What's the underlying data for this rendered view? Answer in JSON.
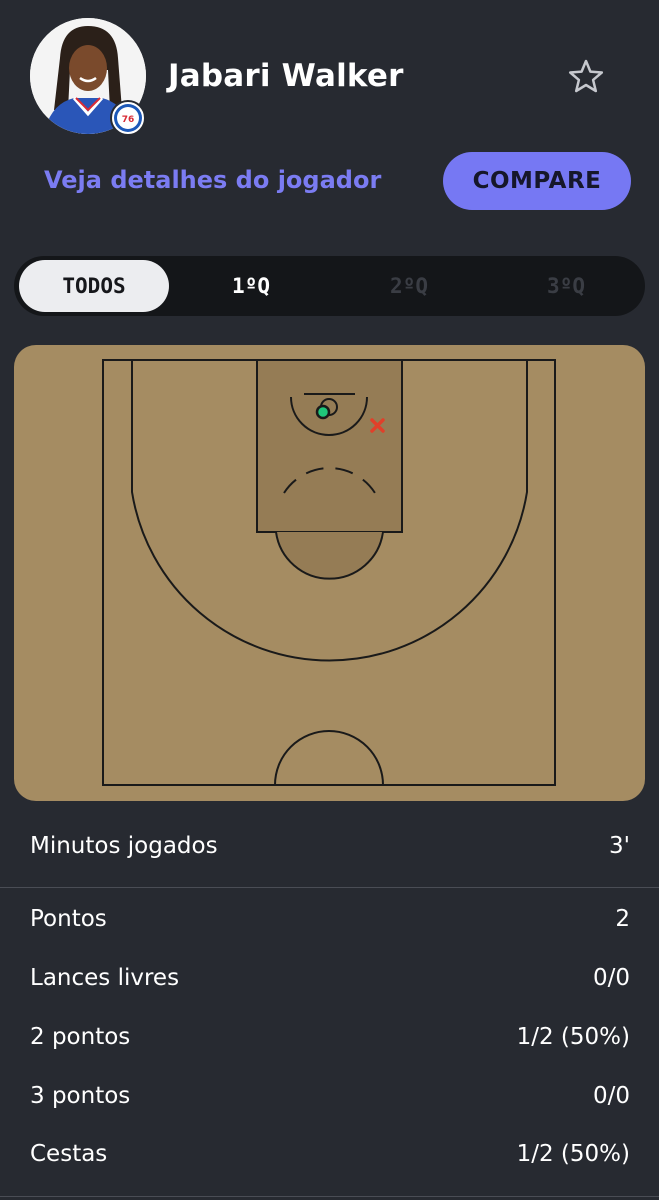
{
  "player": {
    "name": "Jabari Walker",
    "team_badge_text": "76ers",
    "favorite_icon": "star-outline-icon"
  },
  "actions": {
    "details_link": "Veja detalhes do jogador",
    "compare_button": "COMPARE"
  },
  "period_tabs": [
    {
      "label": "TODOS",
      "state": "selected"
    },
    {
      "label": "1ºQ",
      "state": "enabled"
    },
    {
      "label": "2ºQ",
      "state": "disabled"
    },
    {
      "label": "3ºQ",
      "state": "disabled"
    }
  ],
  "shot_chart": {
    "court_color": "#a58c62",
    "shots": [
      {
        "result": "made",
        "color": "#1fc77a",
        "zone": "at-rim"
      },
      {
        "result": "missed",
        "color": "#e0402a",
        "zone": "right-paint"
      }
    ]
  },
  "stats": {
    "minutes": {
      "label": "Minutos jogados",
      "value": "3'"
    },
    "rows": [
      {
        "label": "Pontos",
        "value": "2"
      },
      {
        "label": "Lances livres",
        "value": "0/0"
      },
      {
        "label": "2 pontos",
        "value": "1/2 (50%)"
      },
      {
        "label": "3 pontos",
        "value": "0/0"
      },
      {
        "label": "Cestas",
        "value": "1/2 (50%)"
      }
    ]
  },
  "colors": {
    "background": "#272a31",
    "accent": "#7678f3",
    "link": "#7b7cf2"
  }
}
